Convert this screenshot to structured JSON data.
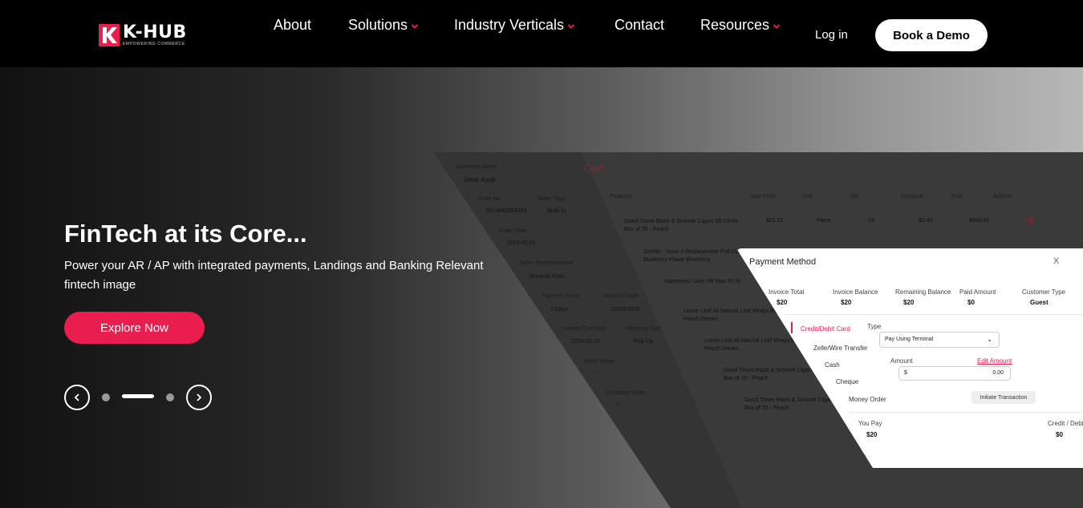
{
  "nav": {
    "logo": {
      "name": "K-HUB",
      "tagline": "EMPOWERING COMMERCE"
    },
    "items": [
      {
        "label": "About",
        "has_dropdown": false
      },
      {
        "label": "Solutions",
        "has_dropdown": true
      },
      {
        "label": "Industry Verticals",
        "has_dropdown": true
      },
      {
        "label": "Contact",
        "has_dropdown": false
      },
      {
        "label": "Resources",
        "has_dropdown": true
      }
    ],
    "login_label": "Log in",
    "demo_label": "Book a Demo"
  },
  "hero": {
    "title": "FinTech at its Core...",
    "subtitle": "Power your AR / AP with integrated payments, Landings and Banking Relevant fintech image",
    "cta_label": "Explore Now",
    "carousel": {
      "slides": 3,
      "active_index": 1
    }
  },
  "mock_screenshot": {
    "cart_title": "Cart",
    "left_fields": [
      {
        "label": "Customer Name",
        "value": "Umar Ayub"
      },
      {
        "label": "Order No.",
        "value": "SO-4842554353"
      },
      {
        "label": "Order Type",
        "value": "Walk In"
      },
      {
        "label": "Order Date",
        "value": "2024-02-01"
      },
      {
        "label": "Sales Representative",
        "value": "Muneeb Khan"
      },
      {
        "label": "Payment Terms",
        "value": "7 Days"
      },
      {
        "label": "Dispatch Date",
        "value": "02/03/2024"
      },
      {
        "label": "Invoice Due Date",
        "value": "2024-02-10"
      },
      {
        "label": "Shipping Type",
        "value": "Pick Up"
      },
      {
        "label": "Order Notes",
        "value": "--"
      },
      {
        "label": "Customer Notes",
        "value": "--"
      }
    ],
    "table_headers": [
      "Products",
      "Sale Price",
      "Unit",
      "Qty",
      "Discount",
      "Total",
      "Actions"
    ],
    "row_1": {
      "product": "Good Times Black & Smooth Cigars 99 Cents Box of 25 - Peach",
      "price": "$21.22",
      "unit": "Piece",
      "qty": "24",
      "discount": "$2.44",
      "total": "$450.42"
    },
    "other_rows": [
      "Smoke - Novo 4 Replacement Pod Flavor Blueberry Flavor Blueberry",
      "Vaporesso Luxe XR Max 80 W",
      "Loose Leaf All Natural Leaf Wraps Box of 5 - Peach Dream",
      "Loose Leaf All Natural Leaf Wraps Box of 5 - Peach Dream",
      "Good Times Black & Smooth Cigars Cents Box of 25 - Peach",
      "Good Times Black & Smooth Cigars Cents Box of 25 - Peach"
    ]
  },
  "payment_modal": {
    "title": "Payment Method",
    "close": "X",
    "summary": [
      {
        "label": "Invoice Total",
        "value": "$20"
      },
      {
        "label": "Invoice Balance",
        "value": "$20"
      },
      {
        "label": "Remaining Balance",
        "value": "$20"
      },
      {
        "label": "Paid Amount",
        "value": "$0"
      },
      {
        "label": "Customer Type",
        "value": "Guest"
      }
    ],
    "methods": [
      "Credit/Debit Card",
      "Zelle/Wire Transfer",
      "Cash",
      "Cheque",
      "Money Order"
    ],
    "active_method": "Credit/Debit Card",
    "type_label": "Type",
    "type_value": "Pay Using Terminal",
    "amount_label": "Amount",
    "edit_amount": "Edit Amount",
    "currency": "$",
    "amount_value": "0.00",
    "initiate_label": "Initiate Transaction",
    "you_pay_label": "You Pay",
    "you_pay_value": "$20",
    "credit_label": "Credit / Debit",
    "credit_value": "$0"
  },
  "colors": {
    "accent": "#e91e4e",
    "nav_bg": "#000000",
    "button_bg": "#ffffff"
  }
}
